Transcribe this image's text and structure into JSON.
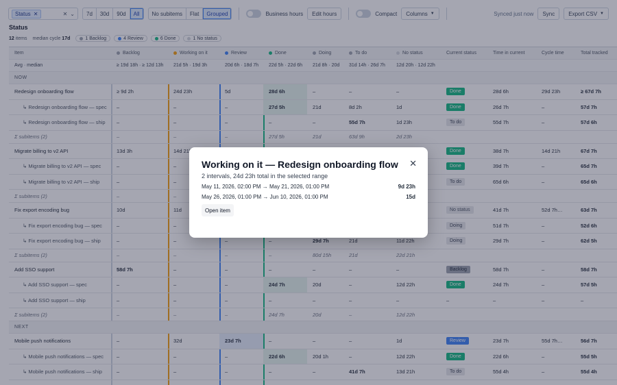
{
  "toolbar": {
    "filter_chip": "Status",
    "ranges": [
      "7d",
      "30d",
      "90d",
      "All"
    ],
    "active_range": "All",
    "views": [
      "No subitems",
      "Flat",
      "Grouped"
    ],
    "active_view": "Grouped",
    "business_hours_label": "Business hours",
    "edit_hours_label": "Edit hours",
    "compact_label": "Compact",
    "columns_label": "Columns",
    "synced_label": "Synced just now",
    "sync_label": "Sync",
    "export_label": "Export CSV"
  },
  "page": {
    "title": "Status",
    "items_count": "12",
    "items_label": "items",
    "median_label": "median cycle",
    "median_value": "17d",
    "pills": [
      {
        "label": "1 Backlog",
        "color": "#9ca3af"
      },
      {
        "label": "4 Review",
        "color": "#3b82f6"
      },
      {
        "label": "6 Done",
        "color": "#10b981"
      },
      {
        "label": "1 No status",
        "color": "#d1d5db"
      }
    ]
  },
  "columns": [
    {
      "label": "Item",
      "color": ""
    },
    {
      "label": "Backlog",
      "color": "#9ca3af"
    },
    {
      "label": "Working on it",
      "color": "#f59e0b"
    },
    {
      "label": "Review",
      "color": "#3b82f6"
    },
    {
      "label": "Done",
      "color": "#10b981"
    },
    {
      "label": "Doing",
      "color": "#9ca3af"
    },
    {
      "label": "To do",
      "color": "#9ca3af"
    },
    {
      "label": "No status",
      "color": "#d1d5db"
    },
    {
      "label": "Current status",
      "color": ""
    },
    {
      "label": "Time in current",
      "color": ""
    },
    {
      "label": "Cycle time",
      "color": ""
    },
    {
      "label": "Total tracked",
      "color": ""
    }
  ],
  "avg_row": [
    "Avg · median",
    "≥ 19d 18h · ≥ 12d 13h",
    "21d 5h · 19d 3h",
    "20d 6h · 18d 7h",
    "22d 5h · 22d 6h",
    "21d 8h · 20d",
    "31d 14h · 26d 7h",
    "12d 20h · 12d 22h",
    "",
    "",
    "",
    ""
  ],
  "rows": [
    {
      "type": "section",
      "cells": [
        "NOW"
      ]
    },
    {
      "type": "item",
      "cells": [
        "Redesign onboarding flow",
        "≥ 9d 2h",
        "24d 23h",
        "5d",
        "28d 6h",
        "–",
        "–",
        "–",
        "",
        "28d 6h",
        "29d 23h",
        "≥ 67d 7h"
      ],
      "status": {
        "label": "Done",
        "kind": "done"
      },
      "bold": [
        4,
        11
      ]
    },
    {
      "type": "sub",
      "cells": [
        "↳ Redesign onboarding flow — spec",
        "–",
        "–",
        "–",
        "27d 5h",
        "21d",
        "8d 2h",
        "1d",
        "",
        "26d 7h",
        "–",
        "57d 7h"
      ],
      "status": {
        "label": "Done",
        "kind": "done"
      },
      "bold": [
        4,
        11
      ]
    },
    {
      "type": "sub",
      "cells": [
        "↳ Redesign onboarding flow — ship",
        "–",
        "–",
        "–",
        "–",
        "–",
        "55d 7h",
        "1d 23h",
        "",
        "55d 7h",
        "–",
        "57d 6h"
      ],
      "status": {
        "label": "To do",
        "kind": "todo"
      },
      "bold": [
        6,
        11
      ]
    },
    {
      "type": "sum",
      "cells": [
        "Σ subitems (2)",
        "–",
        "–",
        "–",
        "27d 5h",
        "21d",
        "63d 9h",
        "2d 23h",
        "",
        "",
        "",
        ""
      ]
    },
    {
      "type": "item",
      "cells": [
        "Migrate billing to v2 API",
        "13d 3h",
        "14d 21h",
        "",
        "",
        "",
        "",
        "",
        "",
        "38d 7h",
        "14d 21h",
        "67d 7h"
      ],
      "status": {
        "label": "Done",
        "kind": "done"
      },
      "bold": [
        11
      ]
    },
    {
      "type": "sub",
      "cells": [
        "↳ Migrate billing to v2 API — spec",
        "–",
        "–",
        "",
        "",
        "",
        "",
        "",
        "",
        "39d 7h",
        "–",
        "65d 7h"
      ],
      "status": {
        "label": "Done",
        "kind": "done"
      },
      "bold": [
        11
      ]
    },
    {
      "type": "sub",
      "cells": [
        "↳ Migrate billing to v2 API — ship",
        "–",
        "–",
        "",
        "",
        "",
        "",
        "",
        "",
        "65d 6h",
        "–",
        "65d 6h"
      ],
      "status": {
        "label": "To do",
        "kind": "todo"
      },
      "bold": [
        11
      ]
    },
    {
      "type": "sum",
      "cells": [
        "Σ subitems (2)",
        "–",
        "–",
        "",
        "",
        "",
        "",
        "",
        "",
        "",
        "",
        ""
      ]
    },
    {
      "type": "item",
      "cells": [
        "Fix export encoding bug",
        "10d",
        "11d",
        "",
        "",
        "",
        "",
        "",
        "",
        "41d 7h",
        "52d 7h…",
        "63d 7h"
      ],
      "status": {
        "label": "No status",
        "kind": "nostatus"
      },
      "bold": [
        11
      ]
    },
    {
      "type": "sub",
      "cells": [
        "↳ Fix export encoding bug — spec",
        "–",
        "–",
        "",
        "",
        "",
        "",
        "",
        "",
        "51d 7h",
        "–",
        "52d 6h"
      ],
      "status": {
        "label": "Doing",
        "kind": "doing"
      },
      "bold": [
        11
      ]
    },
    {
      "type": "sub",
      "cells": [
        "↳ Fix export encoding bug — ship",
        "–",
        "–",
        "–",
        "–",
        "29d 7h",
        "21d",
        "11d 22h",
        "",
        "29d 7h",
        "–",
        "62d 5h"
      ],
      "status": {
        "label": "Doing",
        "kind": "doing"
      },
      "bold": [
        5,
        11
      ]
    },
    {
      "type": "sum",
      "cells": [
        "Σ subitems (2)",
        "–",
        "–",
        "–",
        "–",
        "80d 15h",
        "21d",
        "22d 21h",
        "",
        "",
        "",
        ""
      ]
    },
    {
      "type": "item",
      "cells": [
        "Add SSO support",
        "58d 7h",
        "–",
        "–",
        "–",
        "–",
        "–",
        "–",
        "",
        "58d 7h",
        "–",
        "58d 7h"
      ],
      "status": {
        "label": "Backlog",
        "kind": "backlog"
      },
      "bold": [
        1,
        11
      ]
    },
    {
      "type": "sub",
      "cells": [
        "↳ Add SSO support — spec",
        "–",
        "–",
        "–",
        "24d 7h",
        "20d",
        "–",
        "12d 22h",
        "",
        "24d 7h",
        "–",
        "57d 5h"
      ],
      "status": {
        "label": "Done",
        "kind": "done"
      },
      "bold": [
        4,
        11
      ]
    },
    {
      "type": "sub",
      "cells": [
        "↳ Add SSO support — ship",
        "–",
        "–",
        "–",
        "–",
        "–",
        "–",
        "–",
        "",
        "–",
        "–",
        "–"
      ],
      "status": {
        "label": "–",
        "kind": "none"
      },
      "bold": []
    },
    {
      "type": "sum",
      "cells": [
        "Σ subitems (2)",
        "–",
        "–",
        "–",
        "24d 7h",
        "20d",
        "–",
        "12d 22h",
        "",
        "",
        "",
        ""
      ]
    },
    {
      "type": "section",
      "cells": [
        "NEXT"
      ]
    },
    {
      "type": "item",
      "cells": [
        "Mobile push notifications",
        "–",
        "32d",
        "23d 7h",
        "–",
        "–",
        "–",
        "1d",
        "",
        "23d 7h",
        "55d 7h…",
        "56d 7h"
      ],
      "status": {
        "label": "Review",
        "kind": "review"
      },
      "bold": [
        3,
        11
      ]
    },
    {
      "type": "sub",
      "cells": [
        "↳ Mobile push notifications — spec",
        "–",
        "–",
        "–",
        "22d 6h",
        "20d 1h",
        "–",
        "12d 22h",
        "",
        "22d 6h",
        "–",
        "55d 5h"
      ],
      "status": {
        "label": "Done",
        "kind": "done"
      },
      "bold": [
        4,
        11
      ]
    },
    {
      "type": "sub",
      "cells": [
        "↳ Mobile push notifications — ship",
        "–",
        "–",
        "–",
        "–",
        "–",
        "41d 7h",
        "13d 21h",
        "",
        "55d 4h",
        "–",
        "55d 4h"
      ],
      "status": {
        "label": "To do",
        "kind": "todo"
      },
      "bold": [
        6,
        11
      ]
    }
  ],
  "modal": {
    "title": "Working on it — Redesign onboarding flow",
    "subtitle": "2 intervals, 24d 23h total in the selected range",
    "intervals": [
      {
        "range": "May 11, 2026, 02:00 PM → May 21, 2026, 01:00 PM",
        "duration": "9d 23h"
      },
      {
        "range": "May 26, 2026, 01:00 PM → Jun 10, 2026, 01:00 PM",
        "duration": "15d"
      }
    ],
    "open_label": "Open item",
    "close_glyph": "✕"
  }
}
